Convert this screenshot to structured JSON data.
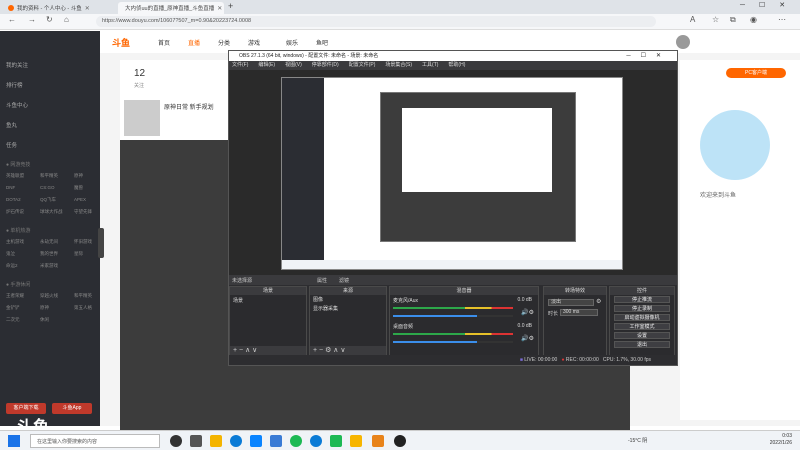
{
  "browser": {
    "tabs": [
      {
        "label": "我的资料 - 个人中心 - 斗鱼"
      },
      {
        "label": "大内侦uu的直播_原神直播_斗鱼直播"
      }
    ],
    "url": "https://www.douyu.com/10607?507_m=0.90&20223724.0008",
    "new_tab": "+"
  },
  "site": {
    "nav": [
      "首页",
      "直播",
      "分类",
      "游戏",
      "娱乐",
      "鱼吧"
    ],
    "sidebar": {
      "items": [
        {
          "label": "我的关注"
        },
        {
          "label": "排行榜"
        },
        {
          "label": "斗鱼中心"
        },
        {
          "label": "鱼丸"
        },
        {
          "label": "任务"
        }
      ],
      "sections": [
        {
          "title": "● 网游竞技",
          "grid": [
            "英雄联盟",
            "和平精英",
            "原神",
            "DNF",
            "CS:GO",
            "魔兽",
            "DOTA2",
            "QQ飞车",
            "APEX",
            "炉石传说",
            "球球大作战",
            "守望先锋"
          ]
        },
        {
          "title": "● 单机热游",
          "grid": [
            "主机游戏",
            "永劫无间",
            "怀旧游戏",
            "鬼泣",
            "我的世界",
            "星际",
            "命运2",
            "米家游戏"
          ]
        },
        {
          "title": "● 手游休闲",
          "grid": [
            "王者荣耀",
            "穿越火线",
            "和平精英",
            "金铲铲",
            "原神",
            "第五人格",
            "二次元",
            "休闲"
          ]
        }
      ],
      "buttons": [
        "客户端下载",
        "斗鱼App"
      ]
    },
    "stats": {
      "count": "12",
      "count_label": "关注"
    },
    "stream_title": "原神日常 新手规划",
    "right_panel": {
      "badge": "PC客户端",
      "text": "欢迎来到斗鱼"
    }
  },
  "obs": {
    "title": "OBS 27.1.3 (64 bit, windows) - 配置文件: 未命名 - 场景: 未命名",
    "menu": [
      "文件(F)",
      "编辑(E)",
      "视图(V)",
      "停靠部件(D)",
      "配置文件(P)",
      "场景集合(S)",
      "工具(T)",
      "帮助(H)"
    ],
    "subbar": {
      "title": "未选择源",
      "properties": "属性",
      "filters": "滤镜"
    },
    "docks": {
      "scenes": {
        "title": "场景",
        "items": [
          "场景"
        ]
      },
      "sources": {
        "title": "来源",
        "items": [
          "图像",
          "显示器采集"
        ]
      },
      "mixer": {
        "title": "混音器",
        "channels": [
          {
            "name": "麦克风/Aux",
            "db": "0.0 dB"
          },
          {
            "name": "桌面音频",
            "db": "0.0 dB"
          }
        ]
      },
      "transitions": {
        "title": "转场特效",
        "fade": "淡出",
        "duration_label": "时长",
        "duration": "300 ms"
      },
      "controls": {
        "title": "控件",
        "buttons": [
          "停止推流",
          "停止录制",
          "启动虚拟摄像机",
          "工作室模式",
          "设置",
          "退出"
        ]
      }
    },
    "status": {
      "live": "LIVE: 00:00:00",
      "rec": "REC: 00:00:00",
      "cpu": "CPU: 1.7%, 30.00 fps"
    }
  },
  "taskbar": {
    "search_placeholder": "在这里输入你要搜索的内容",
    "weather": "-15°C 阴",
    "time": "0:03",
    "date": "2022/1/26"
  },
  "logo": "斗鱼"
}
